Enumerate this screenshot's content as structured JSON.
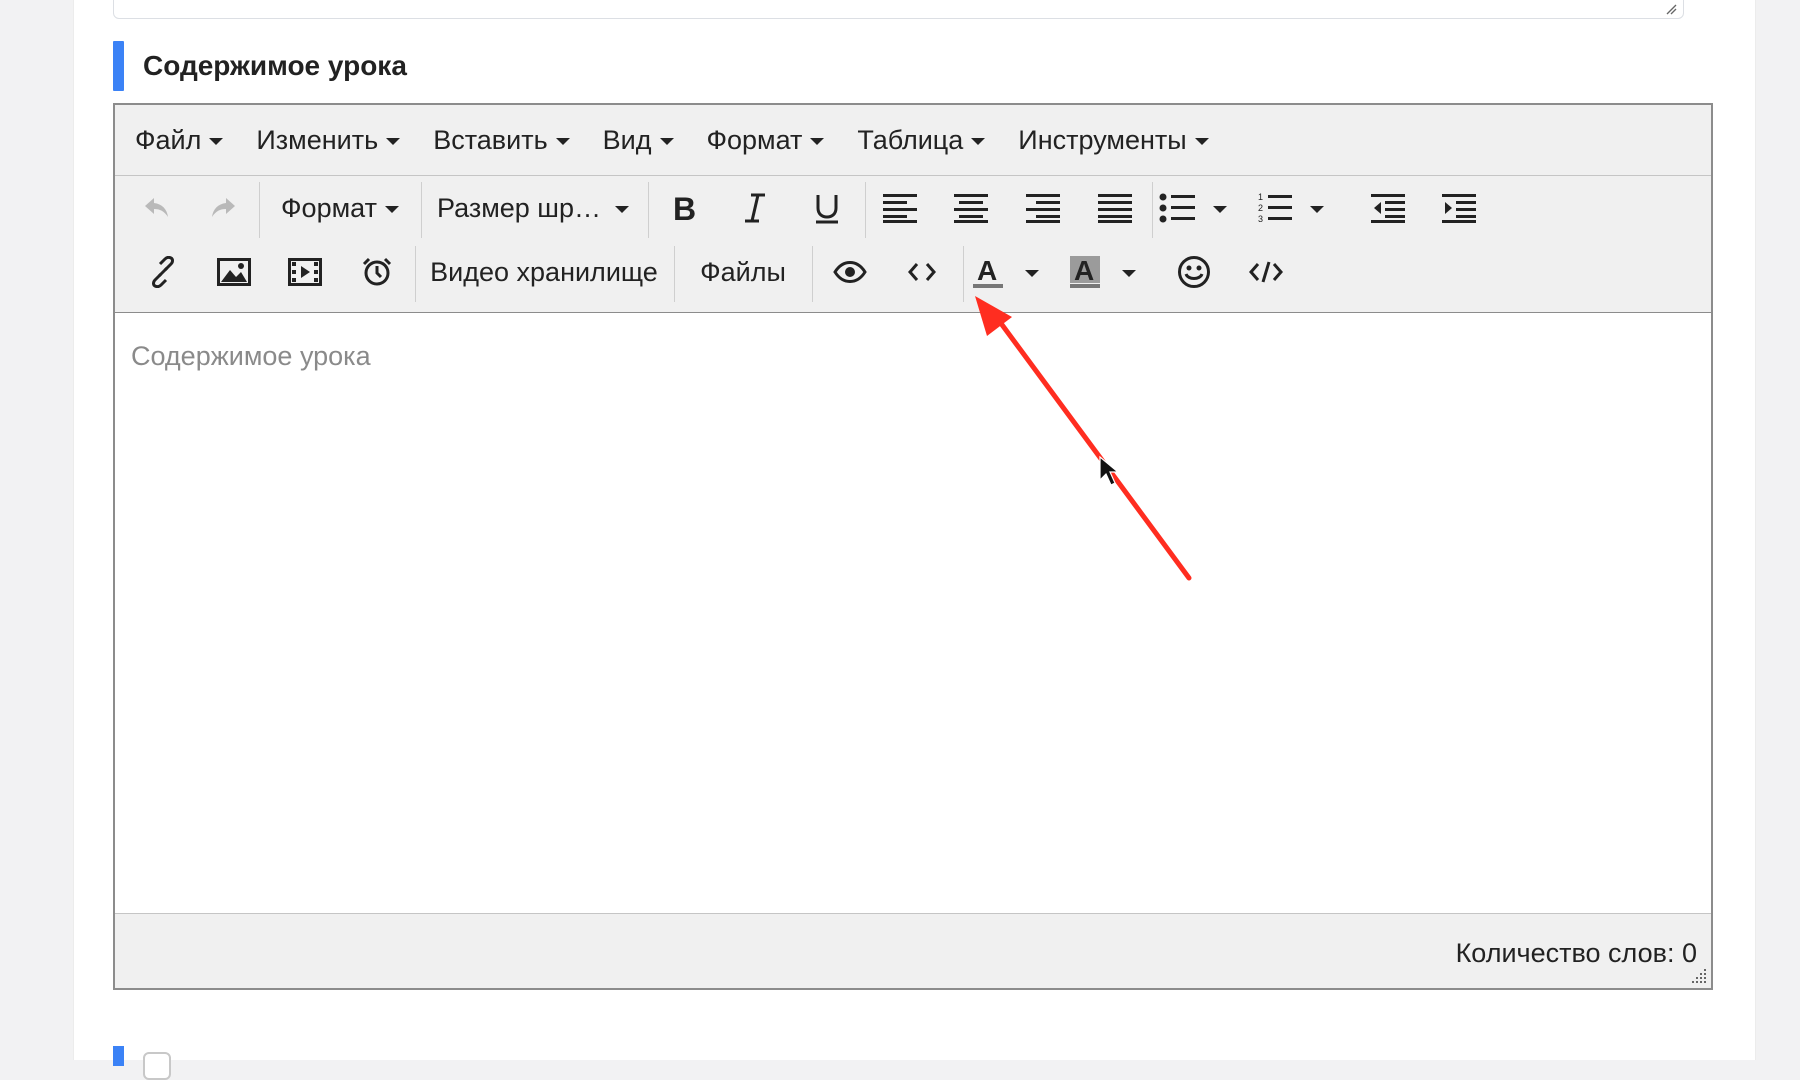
{
  "section": {
    "title": "Содержимое урока"
  },
  "menubar": {
    "items": [
      {
        "label": "Файл"
      },
      {
        "label": "Изменить"
      },
      {
        "label": "Вставить"
      },
      {
        "label": "Вид"
      },
      {
        "label": "Формат"
      },
      {
        "label": "Таблица"
      },
      {
        "label": "Инструменты"
      }
    ]
  },
  "toolbar": {
    "format_label": "Формат",
    "font_size_label": "Размер шр…",
    "video_storage_label": "Видео хранилище",
    "files_label": "Файлы",
    "text_color_letter": "A",
    "bg_color_letter": "A",
    "icons": [
      "undo-icon",
      "redo-icon",
      "bold-icon",
      "italic-icon",
      "underline-icon",
      "align-left-icon",
      "align-center-icon",
      "align-right-icon",
      "align-justify-icon",
      "bullet-list-icon",
      "numbered-list-icon",
      "outdent-icon",
      "indent-icon",
      "link-icon",
      "image-icon",
      "media-icon",
      "clock-icon",
      "preview-icon",
      "code-sample-icon",
      "text-color-icon",
      "background-color-icon",
      "emoticons-icon",
      "source-code-icon"
    ]
  },
  "editor": {
    "placeholder": "Содержимое урока"
  },
  "status": {
    "word_count": "Количество слов: 0"
  },
  "colors": {
    "accent_bar": "#3b82f6",
    "annotation_arrow": "#ff2d20",
    "toolbar_bg": "#f0f0f0"
  }
}
